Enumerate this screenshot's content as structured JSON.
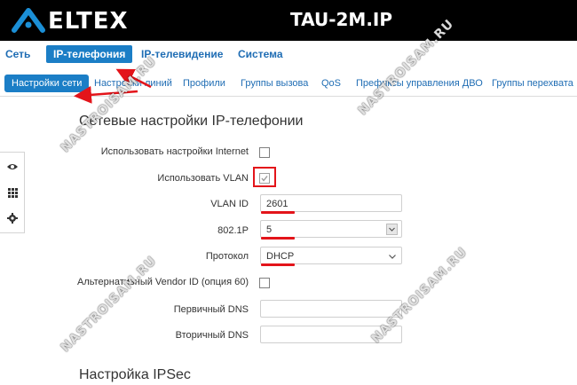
{
  "header": {
    "logo_text": "ELTEX",
    "device_title": "TAU-2M.IP"
  },
  "topnav": {
    "tabs": [
      {
        "label": "Сеть",
        "active": false
      },
      {
        "label": "IP-телефония",
        "active": true
      },
      {
        "label": "IP-телевидение",
        "active": false
      },
      {
        "label": "Система",
        "active": false
      }
    ]
  },
  "subnav": {
    "items": [
      {
        "label": "Настройки сети",
        "active": true
      },
      {
        "label": "Настройки линий",
        "active": false
      },
      {
        "label": "Профили",
        "active": false
      },
      {
        "label": "Группы вызова",
        "active": false
      },
      {
        "label": "QoS",
        "active": false
      },
      {
        "label": "Префиксы управления ДВО",
        "active": false
      },
      {
        "label": "Группы перехвата",
        "active": false
      }
    ]
  },
  "sidebar": {
    "icons": [
      "eye-icon",
      "grid-icon",
      "gear-icon"
    ]
  },
  "section": {
    "title": "Сетевые настройки IP-телефонии",
    "fields": {
      "use_internet": {
        "label": "Использовать настройки Internet",
        "checked": false
      },
      "use_vlan": {
        "label": "Использовать VLAN",
        "checked": true
      },
      "vlan_id": {
        "label": "VLAN ID",
        "value": "2601"
      },
      "priority": {
        "label": "802.1P",
        "value": "5"
      },
      "protocol": {
        "label": "Протокол",
        "value": "DHCP"
      },
      "vendor_id": {
        "label": "Альтернативный Vendor ID (опция 60)",
        "checked": false
      },
      "dns1": {
        "label": "Первичный DNS",
        "value": ""
      },
      "dns2": {
        "label": "Вторичный DNS",
        "value": ""
      }
    }
  },
  "section2": {
    "title": "Настройка IPSec"
  },
  "watermark": "NASTROISAM.RU",
  "colors": {
    "header_bg": "#000000",
    "accent": "#1b7ec6",
    "link": "#1f6db4",
    "highlight": "#e3141a"
  }
}
